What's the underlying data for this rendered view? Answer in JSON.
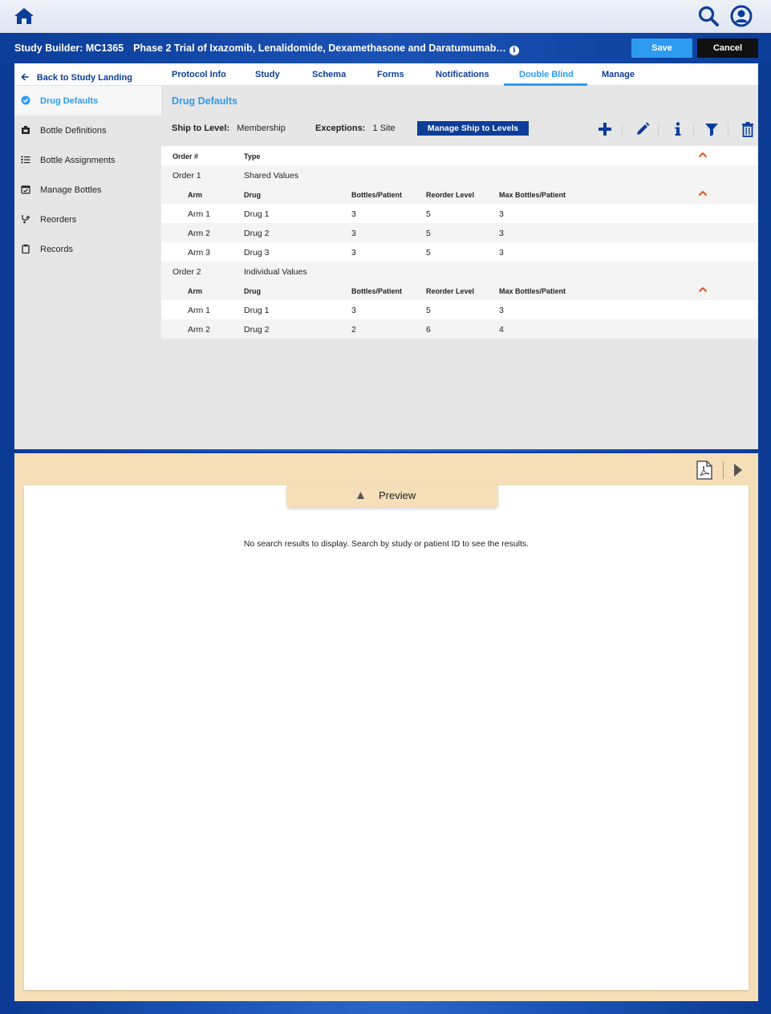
{
  "topbar": {
    "home_icon": "home-icon",
    "search_icon": "search-icon",
    "user_icon": "user-circle-icon"
  },
  "header": {
    "study_label": "Study Builder: MC1365",
    "study_title": "Phase 2 Trial of Ixazomib, Lenalidomide, Dexamethasone and Daratumumab…",
    "save_label": "Save",
    "cancel_label": "Cancel"
  },
  "nav": {
    "back_label": "Back to Study Landing",
    "tabs": [
      "Protocol Info",
      "Study",
      "Schema",
      "Forms",
      "Notifications",
      "Double Blind",
      "Manage"
    ],
    "active_tab": "Double Blind"
  },
  "sidebar": {
    "items": [
      {
        "label": "Drug Defaults",
        "icon": "check-circle-icon",
        "active": true
      },
      {
        "label": "Bottle Definitions",
        "icon": "bottle-icon"
      },
      {
        "label": "Bottle Assignments",
        "icon": "list-icon"
      },
      {
        "label": "Manage Bottles",
        "icon": "calendar-check-icon"
      },
      {
        "label": "Reorders",
        "icon": "reorder-icon"
      },
      {
        "label": "Records",
        "icon": "clipboard-icon"
      }
    ]
  },
  "main": {
    "section_title": "Drug Defaults",
    "ship_label": "Ship to Level:",
    "ship_value": "Membership",
    "exceptions_label": "Exceptions:",
    "exceptions_value": "1 Site",
    "manage_button": "Manage Ship to Levels",
    "table": {
      "headers": {
        "order": "Order #",
        "type": "Type"
      },
      "sub_headers": [
        "Arm",
        "Drug",
        "Bottles/Patient",
        "Reorder Level",
        "Max Bottles/Patient"
      ],
      "orders": [
        {
          "order": "Order 1",
          "type": "Shared Values",
          "rows": [
            [
              "Arm 1",
              "Drug 1",
              "3",
              "5",
              "3"
            ],
            [
              "Arm 2",
              "Drug 2",
              "3",
              "5",
              "3"
            ],
            [
              "Arm 3",
              "Drug 3",
              "3",
              "5",
              "3"
            ]
          ]
        },
        {
          "order": "Order 2",
          "type": "Individual Values",
          "rows": [
            [
              "Arm 1",
              "Drug 1",
              "3",
              "5",
              "3"
            ],
            [
              "Arm 2",
              "Drug 2",
              "2",
              "6",
              "4"
            ]
          ]
        }
      ]
    }
  },
  "preview": {
    "tab_label": "Preview",
    "empty_message": "No search results to display. Search by study or patient ID to see the results."
  },
  "colors": {
    "brand_blue": "#0c3d99",
    "accent_blue": "#2d9bf0",
    "caret_orange": "#e8501f",
    "dock_tan": "#f5dfb9"
  }
}
